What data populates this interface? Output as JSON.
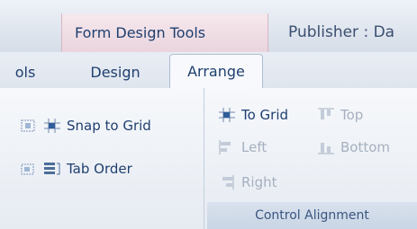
{
  "ribbon": {
    "contextual_tab_group": "Form Design Tools",
    "app_title": "Publisher : Da",
    "tabs": [
      {
        "label": "ols"
      },
      {
        "label": "Design"
      },
      {
        "label": "Arrange"
      }
    ],
    "left_group": {
      "snap_to_grid": "Snap to Grid",
      "tab_order": "Tab Order"
    },
    "control_alignment": {
      "label": "Control Alignment",
      "to_grid": "To Grid",
      "top": "Top",
      "left": "Left",
      "bottom": "Bottom",
      "right": "Right"
    }
  }
}
